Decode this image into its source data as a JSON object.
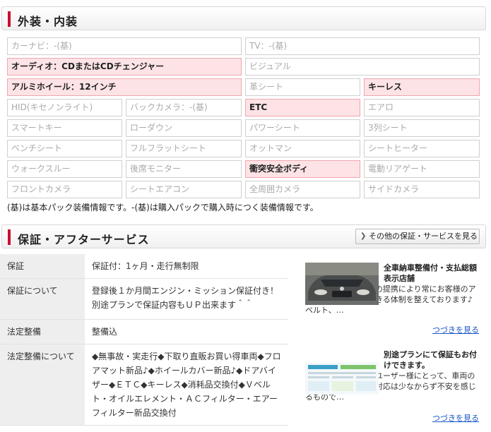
{
  "equipment": {
    "title": "外装・内装",
    "items": [
      {
        "label": "カーナビ：-(基)",
        "on": false
      },
      {
        "label": "TV：-(基)",
        "on": false
      },
      {
        "label": "オーディオ：CDまたはCDチェンジャー",
        "on": true
      },
      {
        "label": "ビジュアル",
        "on": false
      },
      {
        "label": "アルミホイール：12インチ",
        "on": true
      },
      {
        "label": "革シート",
        "on": false
      },
      {
        "label": "キーレス",
        "on": true
      },
      {
        "label": "HID(キセノンライト)",
        "on": false
      },
      {
        "label": "バックカメラ：-(基)",
        "on": false
      },
      {
        "label": "ETC",
        "on": true
      },
      {
        "label": "エアロ",
        "on": false
      },
      {
        "label": "スマートキー",
        "on": false
      },
      {
        "label": "ローダウン",
        "on": false
      },
      {
        "label": "パワーシート",
        "on": false
      },
      {
        "label": "3列シート",
        "on": false
      },
      {
        "label": "ベンチシート",
        "on": false
      },
      {
        "label": "フルフラットシート",
        "on": false
      },
      {
        "label": "オットマン",
        "on": false
      },
      {
        "label": "シートヒーター",
        "on": false
      },
      {
        "label": "ウォークスルー",
        "on": false
      },
      {
        "label": "後席モニター",
        "on": false
      },
      {
        "label": "衝突安全ボディ",
        "on": true
      },
      {
        "label": "電動リアゲート",
        "on": false
      },
      {
        "label": "フロントカメラ",
        "on": false
      },
      {
        "label": "シートエアコン",
        "on": false
      },
      {
        "label": "全周囲カメラ",
        "on": false
      },
      {
        "label": "サイドカメラ",
        "on": false
      }
    ],
    "note": "(基)は基本パック装備情報です。-(基)は購入パックで購入時につく装備情報です。"
  },
  "warranty": {
    "title": "保証・アフターサービス",
    "more_button": "その他の保証・サービスを見る",
    "rows": [
      {
        "key": "保証",
        "value": "保証付：1ヶ月・走行無制限"
      },
      {
        "key": "保証について",
        "value": "登録後１か月間エンジン・ミッション保証付き！別途プランで保証内容もＵＰ出来ます＾＾"
      },
      {
        "key": "法定整備",
        "value": "整備込"
      },
      {
        "key": "法定整備について",
        "value": "◆無事故・実走行◆下取り直販お買い得車両◆フロアマット新品♪◆ホイールカバー新品♪◆ドアバイザー◆ＥＴＣ◆キーレス◆消耗品交換付◆Ｖベルト・オイルエレメント・ＡＣフィルター・エアーフィルター新品交換付"
      }
    ],
    "promos": [
      {
        "title": "全車納車整備付・支払総額表示店舗",
        "body": "提携認証指定工場との提携により常にお客様のアフターケアに対応できる体制を整えております♪ベルト、…",
        "more": "つづきを見る"
      },
      {
        "title": "別途プランにて保証もお付けできます。",
        "body": "中古車を購入されるユーザー様にとって、車両の故障やトラブル時の対応は少なからず不安を感じるもので…",
        "more": "つづきを見る"
      }
    ]
  }
}
